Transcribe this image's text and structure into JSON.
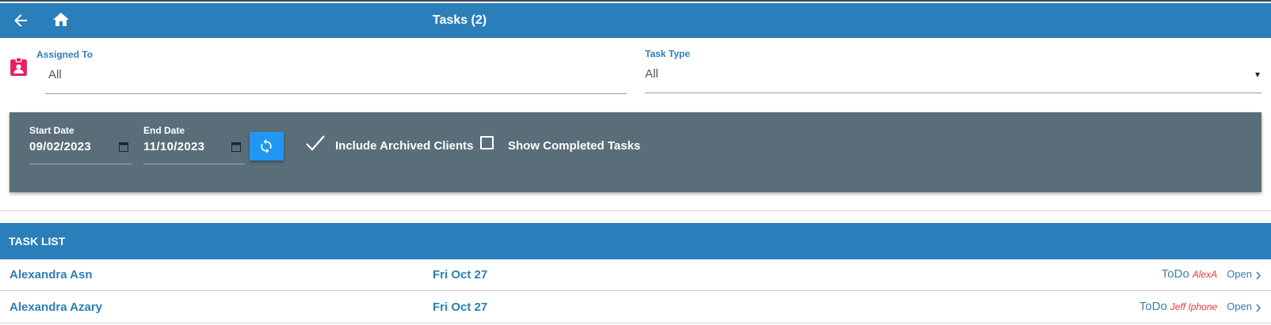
{
  "header": {
    "title": "Tasks (2)",
    "back_icon": "arrow-left-icon",
    "home_icon": "home-icon",
    "background_color": "#2a7fba"
  },
  "filters": {
    "assigned_to": {
      "label": "Assigned To",
      "value": "All",
      "icon": "person-badge-icon",
      "icon_color": "#e91e63"
    },
    "task_type": {
      "label": "Task Type",
      "value": "All",
      "caret": "▾"
    }
  },
  "date_panel": {
    "start_date": {
      "label": "Start Date",
      "value": "09/02/2023"
    },
    "end_date": {
      "label": "End Date",
      "value": "11/10/2023"
    },
    "refresh_icon": "refresh-icon",
    "include_archived": {
      "label": "Include Archived Clients",
      "checked": true
    },
    "show_completed": {
      "label": "Show Completed Tasks",
      "checked": false
    },
    "background_color": "#5a6e7a",
    "accent_color": "#2196f3"
  },
  "task_list": {
    "title": "TASK LIST",
    "rows": [
      {
        "name": "Alexandra Asn",
        "date": "Fri Oct 27",
        "type": "ToDo",
        "assignee": "AlexA",
        "action": "Open"
      },
      {
        "name": "Alexandra Azary",
        "date": "Fri Oct 27",
        "type": "ToDo",
        "assignee": "Jeff Iphone",
        "action": "Open"
      }
    ]
  }
}
